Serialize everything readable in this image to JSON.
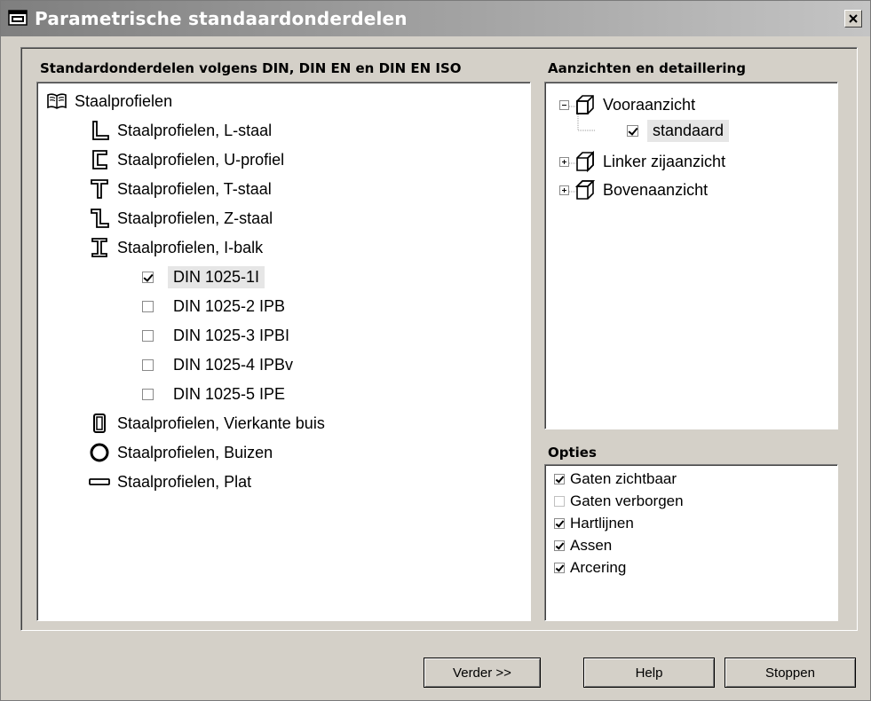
{
  "window": {
    "title": "Parametrische standaardonderdelen"
  },
  "left_panel": {
    "heading": "Standardonderdelen volgens DIN, DIN EN en DIN EN ISO",
    "root_label": "Staalprofielen",
    "items": [
      {
        "label": "Staalprofielen, L-staal",
        "icon": "l-profile-icon"
      },
      {
        "label": "Staalprofielen, U-profiel",
        "icon": "u-profile-icon"
      },
      {
        "label": "Staalprofielen, T-staal",
        "icon": "t-profile-icon"
      },
      {
        "label": "Staalprofielen, Z-staal",
        "icon": "z-profile-icon"
      },
      {
        "label": "Staalprofielen, I-balk",
        "icon": "i-beam-icon"
      }
    ],
    "sub_items": [
      {
        "label": "DIN 1025-1I",
        "checked": true,
        "selected": true
      },
      {
        "label": "DIN 1025-2 IPB",
        "checked": false
      },
      {
        "label": "DIN 1025-3 IPBI",
        "checked": false
      },
      {
        "label": "DIN 1025-4 IPBv",
        "checked": false
      },
      {
        "label": "DIN 1025-5 IPE",
        "checked": false
      }
    ],
    "items_after": [
      {
        "label": "Staalprofielen, Vierkante buis",
        "icon": "square-tube-icon"
      },
      {
        "label": "Staalprofielen, Buizen",
        "icon": "round-tube-icon"
      },
      {
        "label": "Staalprofielen, Plat",
        "icon": "flat-bar-icon"
      }
    ]
  },
  "right_panel": {
    "heading": "Aanzichten en detaillering",
    "views": [
      {
        "label": "Vooraanzicht",
        "expanded": true,
        "children": [
          {
            "label": "standaard",
            "checked": true
          }
        ]
      },
      {
        "label": "Linker zijaanzicht",
        "expanded": false
      },
      {
        "label": "Bovenaanzicht",
        "expanded": false
      }
    ]
  },
  "options": {
    "heading": "Opties",
    "items": [
      {
        "label": "Gaten zichtbaar",
        "checked": true
      },
      {
        "label": "Gaten verborgen",
        "checked": false
      },
      {
        "label": "Hartlijnen",
        "checked": true
      },
      {
        "label": "Assen",
        "checked": true
      },
      {
        "label": "Arcering",
        "checked": true
      }
    ]
  },
  "buttons": {
    "next": "Verder >>",
    "help": "Help",
    "stop": "Stoppen"
  }
}
